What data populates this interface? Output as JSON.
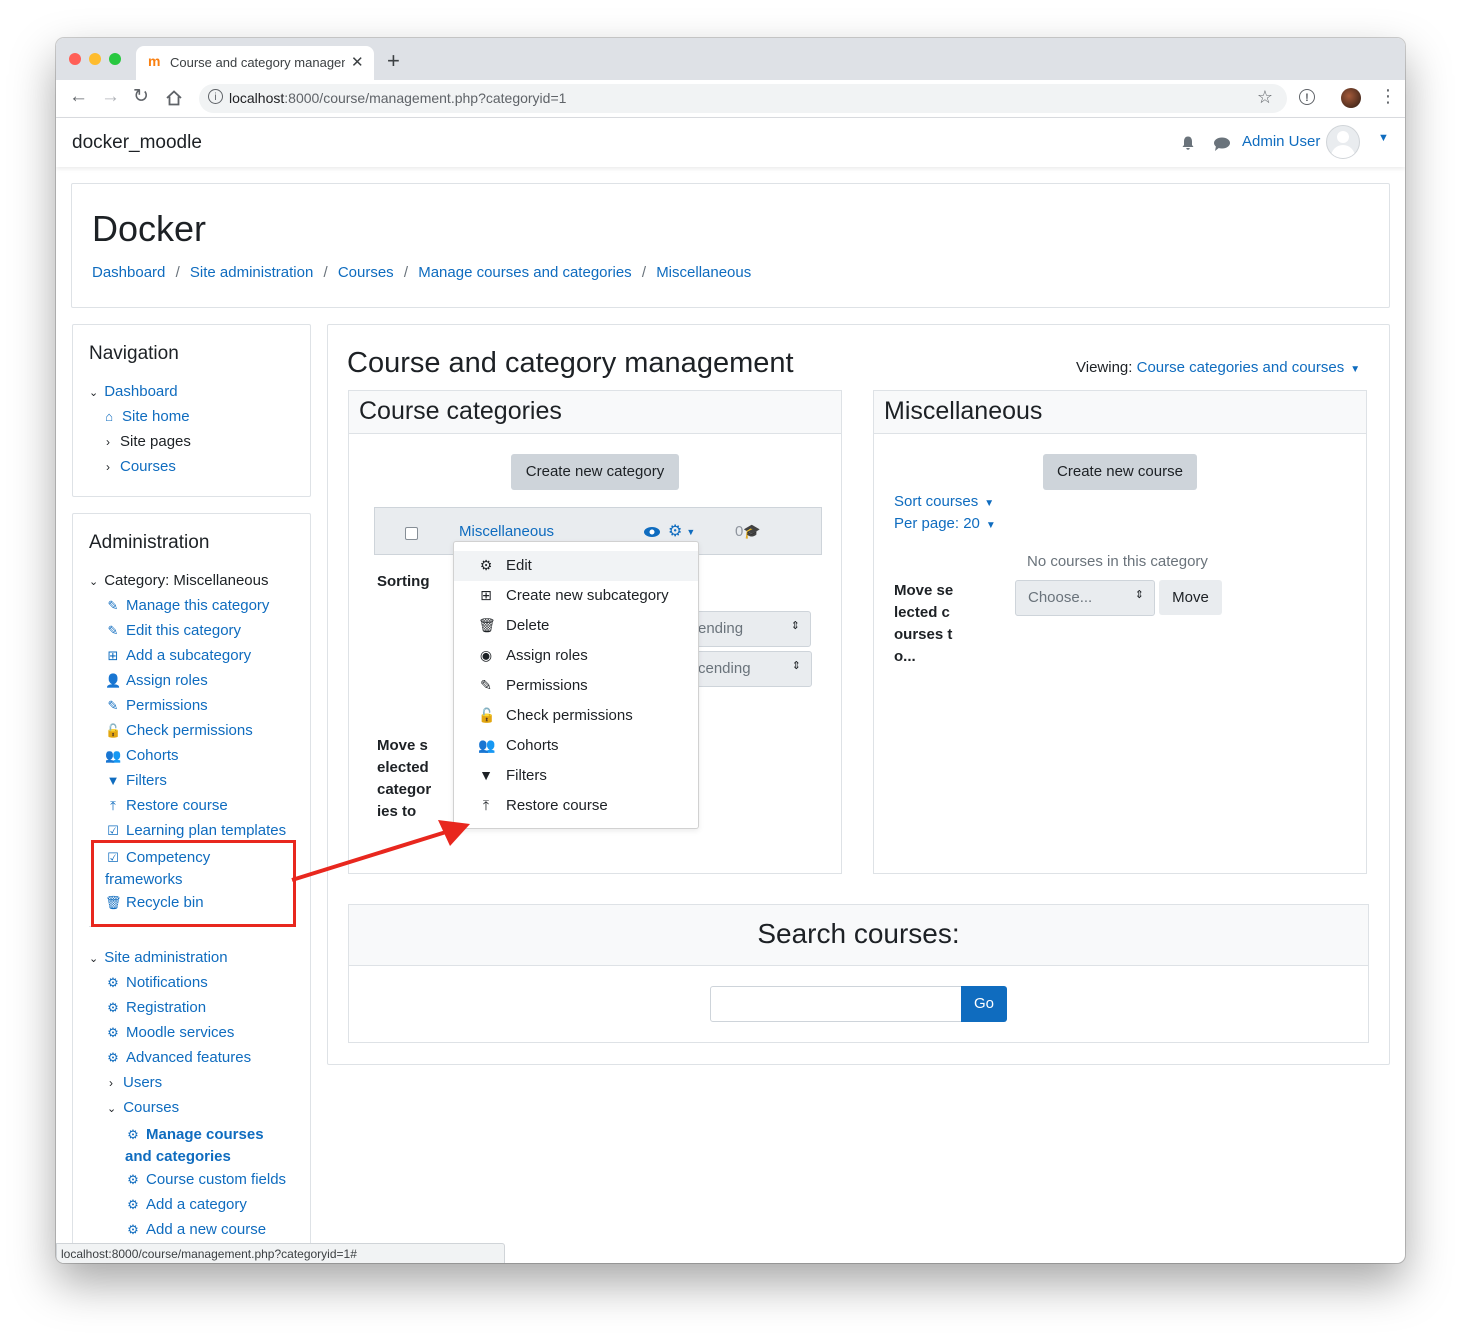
{
  "browser": {
    "tab_title": "Course and category managem",
    "url_host": "localhost",
    "url_rest": ":8000/course/management.php?categoryid=1",
    "status_url": "localhost:8000/course/management.php?categoryid=1#"
  },
  "navbar": {
    "site_name": "docker_moodle",
    "user_name": "Admin User"
  },
  "header": {
    "title": "Docker",
    "breadcrumbs": [
      "Dashboard",
      "Site administration",
      "Courses",
      "Manage courses and categories",
      "Miscellaneous"
    ]
  },
  "navigation_block": {
    "title": "Navigation",
    "items": [
      "Dashboard",
      "Site home",
      "Site pages",
      "Courses"
    ]
  },
  "admin_block": {
    "title": "Administration",
    "category_heading": "Category: Miscellaneous",
    "category_items": [
      "Manage this category",
      "Edit this category",
      "Add a subcategory",
      "Assign roles",
      "Permissions",
      "Check permissions",
      "Cohorts",
      "Filters",
      "Restore course",
      "Learning plan templates",
      "Competency frameworks",
      "Recycle bin"
    ],
    "site_admin": "Site administration",
    "site_admin_items": [
      "Notifications",
      "Registration",
      "Moodle services",
      "Advanced features",
      "Users",
      "Courses"
    ],
    "courses_items": [
      "Manage courses and categories",
      "Course custom fields",
      "Add a category",
      "Add a new course"
    ]
  },
  "main": {
    "title": "Course and category management",
    "viewing_label": "Viewing:",
    "viewing_value": "Course categories and courses",
    "categories_panel": {
      "title": "Course categories",
      "create_button": "Create new category",
      "category_name": "Miscellaneous",
      "course_count": "0",
      "sorting_label": "Sorting",
      "sort_select_1": "ending",
      "sort_select_2": "cending",
      "move_label": "Move selected categories to"
    },
    "dropdown_menu": [
      "Edit",
      "Create new subcategory",
      "Delete",
      "Assign roles",
      "Permissions",
      "Check permissions",
      "Cohorts",
      "Filters",
      "Restore course"
    ],
    "courses_panel": {
      "title": "Miscellaneous",
      "create_button": "Create new course",
      "sort_courses": "Sort courses",
      "per_page": "Per page: 20",
      "empty_text": "No courses in this category",
      "move_label": "Move selected courses to...",
      "choose_placeholder": "Choose...",
      "move_button": "Move"
    },
    "search": {
      "title": "Search courses:",
      "go_button": "Go"
    }
  },
  "colors": {
    "link": "#0f6cbf",
    "annotation": "#e8271e",
    "button_gray": "#ced4da"
  }
}
